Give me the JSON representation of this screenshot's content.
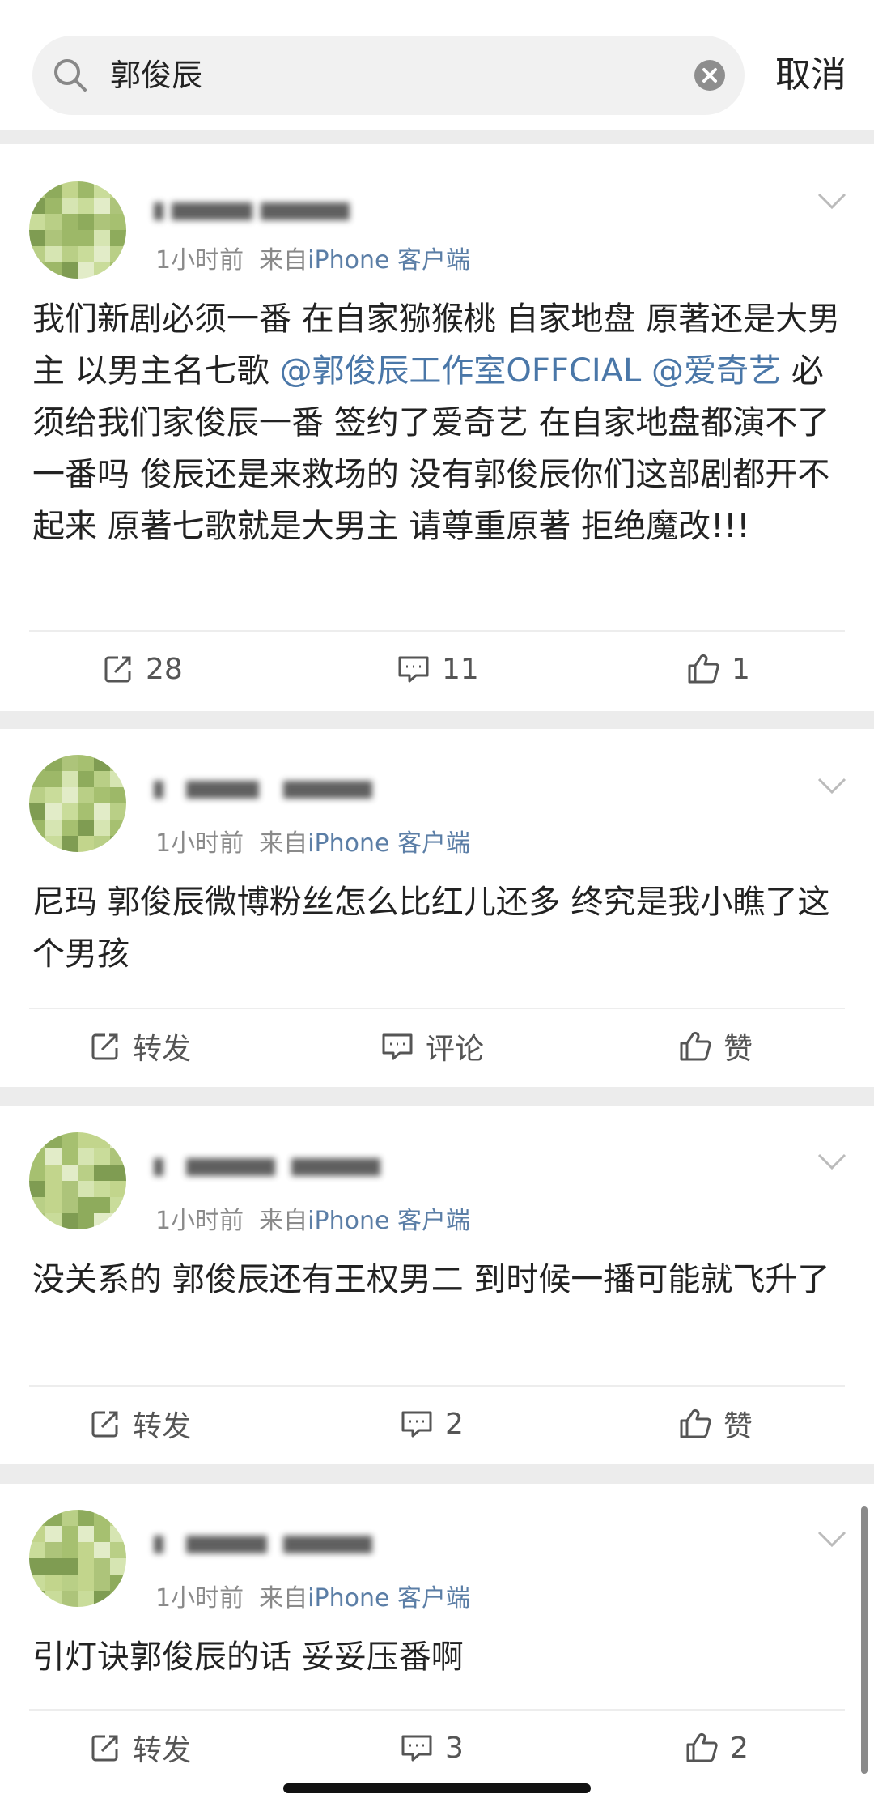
{
  "search": {
    "query": "郭俊辰"
  },
  "header": {
    "cancel_label": "取消"
  },
  "posts": [
    {
      "meta_time": "1小时前",
      "meta_from": "来自",
      "meta_client": "iPhone 客户端",
      "body_parts": [
        "我们新剧必须一番 在自家猕猴桃 自家地盘 原著还是大男主 以男主名七歌 ",
        "@郭俊辰工作室OFFCIAL",
        " ",
        "@爱奇艺",
        " 必须给我们家俊辰一番 签约了爱奇艺 在自家地盘都演不了一番吗 俊辰还是来救场的 没有郭俊辰你们这部剧都开不起来 原著七歌就是大男主 请尊重原著 拒绝魔改!!!"
      ],
      "repost": "28",
      "comment": "11",
      "like": "1"
    },
    {
      "meta_time": "1小时前",
      "meta_from": "来自",
      "meta_client": "iPhone 客户端",
      "body": "尼玛 郭俊辰微博粉丝怎么比红儿还多 终究是我小瞧了这个男孩",
      "repost": "转发",
      "comment": "评论",
      "like": "赞"
    },
    {
      "meta_time": "1小时前",
      "meta_from": "来自",
      "meta_client": "iPhone 客户端",
      "body": "没关系的 郭俊辰还有王权男二 到时候一播可能就飞升了",
      "repost": "转发",
      "comment": "2",
      "like": "赞"
    },
    {
      "meta_time": "1小时前",
      "meta_from": "来自",
      "meta_client": "iPhone 客户端",
      "body": "引灯诀郭俊辰的话 妥妥压番啊",
      "repost": "转发",
      "comment": "3",
      "like": "2"
    }
  ],
  "colors": {
    "link": "#4a77a8",
    "meta": "#8a8a8a",
    "background": "#ececec"
  },
  "icons": [
    "search-icon",
    "clear-icon",
    "chevron-down-icon",
    "repost-icon",
    "comment-icon",
    "like-icon"
  ]
}
